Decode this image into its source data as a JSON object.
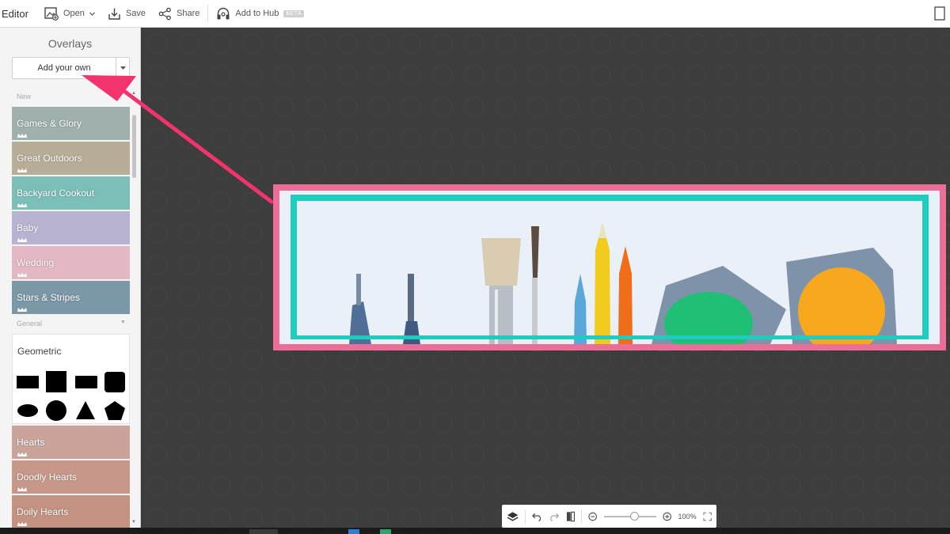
{
  "app": {
    "title": "Editor"
  },
  "toolbar": {
    "open_label": "Open",
    "save_label": "Save",
    "share_label": "Share",
    "hub_label": "Add to Hub",
    "beta_badge": "BETA"
  },
  "sidebar": {
    "title": "Overlays",
    "add_button_label": "Add your own",
    "section_new": "New",
    "section_general": "General",
    "new_items": [
      {
        "label": "Games & Glory",
        "color": "#9fb0ad"
      },
      {
        "label": "Great Outdoors",
        "color": "#b8ad97"
      },
      {
        "label": "Backyard Cookout",
        "color": "#7bbfb8"
      },
      {
        "label": "Baby",
        "color": "#b9b3d2"
      },
      {
        "label": "Wedding",
        "color": "#e3b8c4"
      },
      {
        "label": "Stars & Stripes",
        "color": "#7b98a7"
      }
    ],
    "geometric_label": "Geometric",
    "general_items": [
      {
        "label": "Hearts",
        "color": "#caa49b"
      },
      {
        "label": "Doodly Hearts",
        "color": "#c79789"
      },
      {
        "label": "Doily Hearts",
        "color": "#c49281"
      }
    ]
  },
  "zoom": {
    "level": "100%",
    "slider_fraction": 0.55
  },
  "colors": {
    "banner_pink": "#ec6e97",
    "banner_teal": "#1ecdbf",
    "arrow": "#f2336e"
  }
}
